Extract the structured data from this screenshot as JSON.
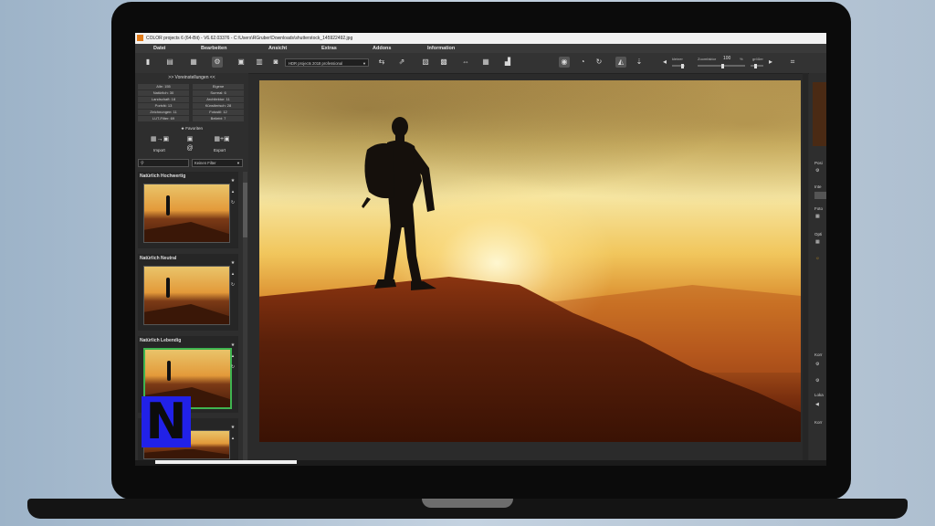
{
  "window": {
    "title": "COLOR projects 6 (64-Bit) - V6.62.03376 - C:\\Users\\RGruber\\Downloads\\shutterstock_145922492.jpg"
  },
  "menu": [
    "Datei",
    "Bearbeiten",
    "Ansicht",
    "Extras",
    "Addons",
    "Information"
  ],
  "toolbar": {
    "preset_select": "HDR projects 2018 professional",
    "slider_left_label": "kleiner",
    "zoom_label": "Zoomfaktor",
    "zoom_value": "100",
    "zoom_unit": "%",
    "slider_right_label": "größer"
  },
  "left_panel": {
    "header": ">> Voreinstellungen <<",
    "categories": [
      "Alle: 155",
      "Eigene",
      "Natürlich: 30",
      "Surreal: 6",
      "Landschaft: 18",
      "Architektur: 11",
      "Porträt: 13",
      "Künstlerisch: 28",
      "Zeichnungen: 11",
      "Fotostil: 12",
      "LUT-Filter: 69",
      "Beliebt: 7"
    ],
    "favorites": "Favoriten",
    "import_label": "Import",
    "export_label": "Export",
    "filter_select": "Keinen Filter",
    "presets": [
      {
        "title": "Natürlich Hochwertig"
      },
      {
        "title": "Natürlich Neutral"
      },
      {
        "title": "Natürlich Lebendig"
      }
    ]
  },
  "right_panel": {
    "labels": [
      "Posi",
      "Inte",
      "Foto",
      "Opti",
      "Korr",
      "Loka",
      "Korr"
    ]
  },
  "overlay": {
    "logo_letter": "N"
  }
}
